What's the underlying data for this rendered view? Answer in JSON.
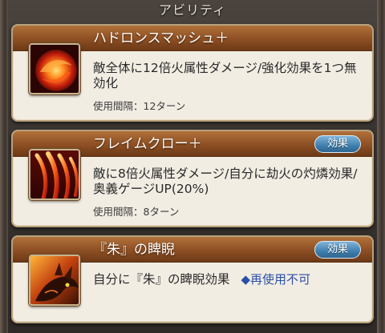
{
  "header": {
    "title": "アビリティ"
  },
  "abilities": [
    {
      "name": "ハドロンスマッシュ＋",
      "description": "敵全体に12倍火属性ダメージ/強化効果を1つ無効化",
      "interval": "使用間隔：12ターン",
      "icon": "fire-orb-icon"
    },
    {
      "name": "フレイムクロー＋",
      "description": "敵に8倍火属性ダメージ/自分に劫火の灼燐効果/奥義ゲージUP(20%)",
      "interval": "使用間隔：8ターン",
      "effect_button": "効果",
      "icon": "flame-claw-icon"
    },
    {
      "name": "『朱』の睥睨",
      "description": "自分に『朱』の睥睨効果",
      "reuse_note": "◆再使用不可",
      "effect_button": "効果",
      "icon": "dragon-gaze-icon"
    }
  ],
  "colors": {
    "card_header": "#8d4f23",
    "card_body": "#f2ede3",
    "effect_button": "#3f7fae",
    "reuse_note": "#2b4fa8"
  }
}
